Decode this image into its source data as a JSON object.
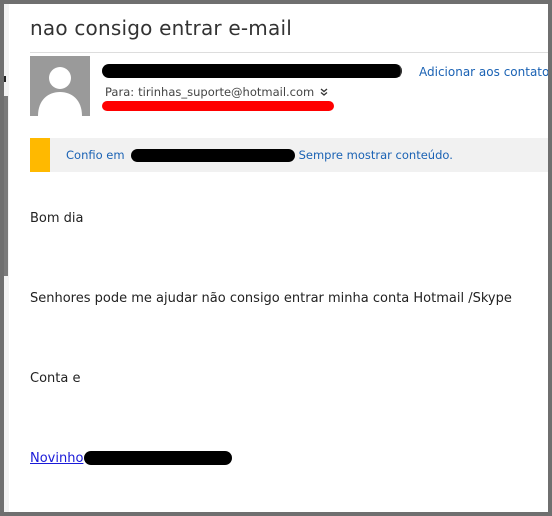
{
  "email": {
    "subject": "nao consigo entrar e-mail",
    "sender_paren": ")",
    "add_contact_label": "Adicionar aos contatos",
    "add_contact_caret": "▼",
    "to_label": "Para:",
    "to_address": "tirinhas_suporte@hotmail.com",
    "trust_prefix": "Confio em",
    "trust_link": "Sempre mostrar conteúdo.",
    "body": {
      "greeting": "Bom dia",
      "line1": "Senhores pode me ajudar não consigo entrar  minha conta Hotmail /Skype",
      "line2": "Conta e",
      "link_text": "Novinho"
    }
  },
  "icons": {
    "avatar": "user-silhouette-icon",
    "expand": "double-chevron-down-icon"
  },
  "colors": {
    "link": "#1a62b4",
    "warning_accent": "#ffb900",
    "redaction_red": "#ff0000",
    "redaction_black": "#000000"
  }
}
